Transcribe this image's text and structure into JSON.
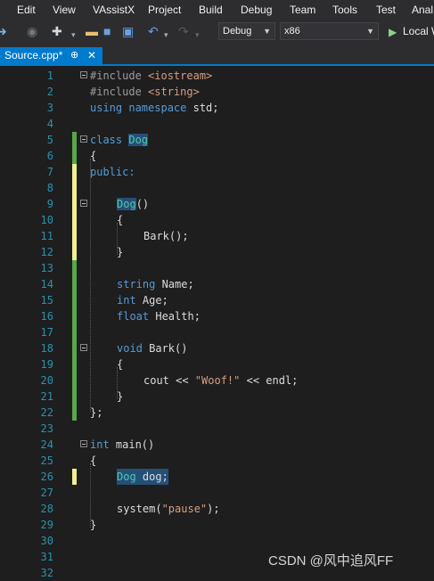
{
  "menubar": {
    "items": [
      "Edit",
      "View",
      "VAssistX",
      "Project",
      "Build",
      "Debug",
      "Team",
      "Tools",
      "Test",
      "Anal"
    ]
  },
  "toolbar": {
    "icons": [
      "navigate-forward-icon",
      "new-project-icon",
      "open-file-icon",
      "save-icon",
      "save-all-icon",
      "undo-icon",
      "redo-icon",
      "start-debugging-icon"
    ],
    "config_label": "Debug",
    "platform_label": "x86",
    "run_label": "Local W"
  },
  "tabs": [
    {
      "label": "Source.cpp*",
      "pin": "⊕",
      "close": "✕"
    }
  ],
  "editor": {
    "line_numbers": [
      "1",
      "2",
      "3",
      "4",
      "5",
      "6",
      "7",
      "8",
      "9",
      "10",
      "11",
      "12",
      "13",
      "14",
      "15",
      "16",
      "17",
      "18",
      "19",
      "20",
      "21",
      "22",
      "23",
      "24",
      "25",
      "26",
      "27",
      "28",
      "29",
      "30",
      "31",
      "32"
    ],
    "code": {
      "l1a": "#include ",
      "l1b": "<iostream>",
      "l2a": "#include ",
      "l2b": "<string>",
      "l3a": "using namespace",
      "l3b": " std;",
      "l5a": "class ",
      "l5b": "Dog",
      "l6": "{",
      "l7": "public:",
      "l9a": "Dog",
      "l9b": "()",
      "l10": "{",
      "l11": "Bark();",
      "l12": "}",
      "l14a": "string",
      "l14b": " Name;",
      "l15a": "int",
      "l15b": " Age;",
      "l16a": "float",
      "l16b": " Health;",
      "l18a": "void",
      "l18b": " Bark()",
      "l19": "{",
      "l20a": "cout << ",
      "l20b": "\"Woof!\"",
      "l20c": " << endl;",
      "l21": "}",
      "l22": "};",
      "l24a": "int",
      "l24b": " main()",
      "l25": "{",
      "l26a": "Dog",
      "l26b": " dog;",
      "l28a": "system(",
      "l28b": "\"pause\"",
      "l28c": ");",
      "l29": "}"
    }
  },
  "watermark": "CSDN @风中追风FF",
  "colors": {
    "background": "#1e1e1e",
    "chrome": "#2d2d30",
    "accent": "#007acc",
    "line_number": "#2b91af",
    "keyword": "#569cd6",
    "string": "#d69d85",
    "type": "#4ec9b0",
    "saved_change_bar": "#57a64a",
    "unsaved_change_bar": "#efef91"
  }
}
